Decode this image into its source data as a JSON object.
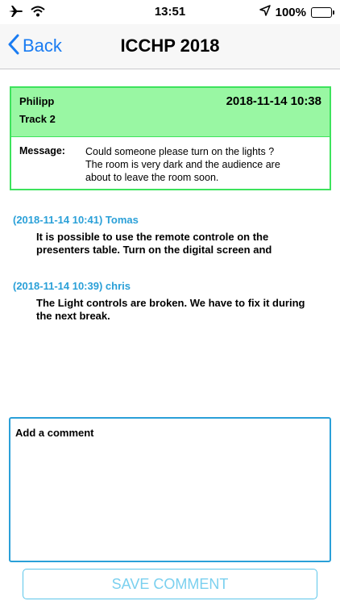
{
  "status_bar": {
    "time": "13:51",
    "battery": "100%",
    "icons": [
      "airplane-icon",
      "wifi-icon",
      "location-arrow-icon",
      "battery-icon"
    ]
  },
  "nav": {
    "back_label": "Back",
    "title": "ICCHP 2018"
  },
  "message": {
    "sender": "Philipp",
    "track": "Track 2",
    "date": "2018-11-14 10:38",
    "label": "Message:",
    "text_lines": [
      "Could someone please turn on the lights ?",
      "The room is very dark and the audience are",
      "about to leave the room soon."
    ]
  },
  "comments": [
    {
      "header": "(2018-11-14 10:41) Tomas",
      "lines": [
        "It is possible to use the remote controle on the",
        "presenters table. Turn on the digital screen and"
      ]
    },
    {
      "header": "(2018-11-14 10:39) chris",
      "lines": [
        "The Light controls are broken. We have to fix it during",
        "the next break."
      ]
    }
  ],
  "comment_input": {
    "placeholder": "Add a comment",
    "value": ""
  },
  "save_button": {
    "label": "SAVE COMMENT"
  },
  "colors": {
    "accent_blue": "#1a7cf2",
    "comment_blue": "#2aa0d8",
    "card_header_green": "#99f7a3",
    "card_border_green": "#3de35c"
  }
}
